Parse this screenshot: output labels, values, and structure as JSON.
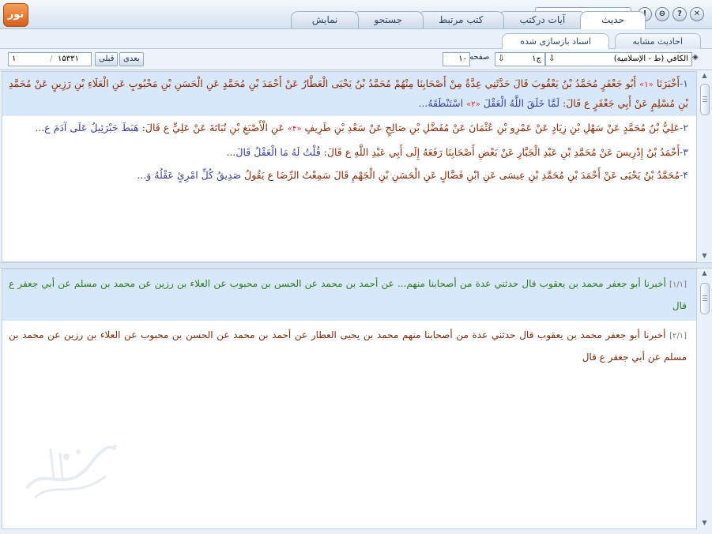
{
  "window": {
    "logo_text": "نور",
    "tabs": [
      "حديث",
      "آيات درکتب",
      "کتب مرتبط",
      "جستجو",
      "نمايش"
    ],
    "active_tab": "حديث",
    "search_placeholder": "",
    "buttons": {
      "close": "✕",
      "help": "?",
      "minimize": "⊖",
      "info": "!"
    }
  },
  "subtabs": [
    "احاديث مشابه",
    "اسناد بازسازی شده"
  ],
  "toolbar": {
    "book_select": "الکافي (ط - الإسلامية)",
    "volume_value": "ج۱",
    "page_label": "صفحه",
    "page_value": "۱۰",
    "prev_label": "قبلی",
    "next_label": "بعدی",
    "total_value": "۱۵۳۳۱",
    "current_value": "۱"
  },
  "hadiths": [
    {
      "num": "۱-",
      "isnad1": "أَخْبَرَنَا",
      "note1": "«۱»",
      "isnad2": "أَبُو جَعْفَرٍ مُحَمَّدُ بْنُ يَعْقُوبَ قَالَ حَدَّثَنِي عِدَّةٌ مِنْ أَصْحَابِنَا مِنْهُمْ مُحَمَّدُ بْنُ يَحْيَى الْعَطَّارُ عَنْ أَحْمَدَ بْنِ مُحَمَّدٍ عَنِ الْحَسَنِ بْنِ مَحْبُوبٍ عَنِ الْعَلَاءِ بْنِ رَزِينٍ عَنْ مُحَمَّدِ بْنِ مُسْلِمٍ عَنْ أَبِي جَعْفَرٍ ع قَالَ:",
      "text": "لَمَّا خَلَقَ اللَّهُ الْعَقْلَ",
      "note2": "«۲»",
      "text2": "اسْتَنْطَقَهُ...",
      "highlight": true
    },
    {
      "num": "۲-",
      "isnad": "عَلِيُّ بْنُ مُحَمَّدٍ عَنْ سَهْلِ بْنِ زِيَادٍ عَنْ عَمْرِو بْنِ عُثْمَانَ عَنْ مُفَضَّلِ بْنِ صَالِحٍ عَنْ سَعْدِ بْنِ طَرِيفٍ",
      "note": "«۴»",
      "isnad_b": "عَنِ الْأَصْبَغِ بْنِ نُبَاتَةَ عَنْ عَلِيٍّ ع قَالَ:",
      "text": "هَبَطَ جَبْرَئِيلُ عَلَى آدَمَ ع...",
      "highlight": false
    },
    {
      "num": "۳-",
      "isnad": "أَحْمَدُ بْنُ إِدْرِيسَ عَنْ مُحَمَّدِ بْنِ عَبْدِ الْجَبَّارِ عَنْ بَعْضِ أَصْحَابِنَا رَفَعَهُ إِلَى أَبِي عَبْدِ اللَّهِ ع قَالَ:",
      "text": "قُلْتُ لَهُ مَا الْعَقْلُ قَالَ...",
      "highlight": false
    },
    {
      "num": "۴-",
      "isnad": "مُحَمَّدُ بْنُ يَحْيَى عَنْ أَحْمَدَ بْنِ مُحَمَّدِ بْنِ عِيسَى عَنِ ابْنِ فَضَّالٍ عَنِ الْحَسَنِ بْنِ الْجَهْمِ قَالَ سَمِعْتُ الرِّضَا ع يَقُولُ",
      "text": "صَدِيقُ كُلِّ امْرِئٍ عَقْلُهُ وَ...",
      "highlight": false
    }
  ],
  "sanads": [
    {
      "ref": "[۱/۱]",
      "lead": "أخبرنا",
      "chain": "أبو جعفر محمد بن يعقوب قال حدثني عدة من أصحابنا منهم... عن أحمد بن محمد عن الحسن بن محبوب عن العلاء بن رزين عن محمد بن مسلم عن أبي جعفر ع قال",
      "highlight": true
    },
    {
      "ref": "[۲/۱]",
      "lead": "أخبرنا",
      "chain": "أبو جعفر محمد بن يعقوب قال حدثني عدة من أصحابنا منهم محمد بن يحيى العطار عن أحمد بن محمد عن الحسن بن محبوب عن العلاء بن رزين عن محمد بن مسلم عن أبي جعفر ع قال",
      "highlight": false
    }
  ],
  "watermark_text": "جامع الأحاديث",
  "colors": {
    "isnad": "#8a2b06",
    "matn": "#3a3fa0",
    "note": "#d2221d",
    "highlight": "#d8e8fa"
  }
}
